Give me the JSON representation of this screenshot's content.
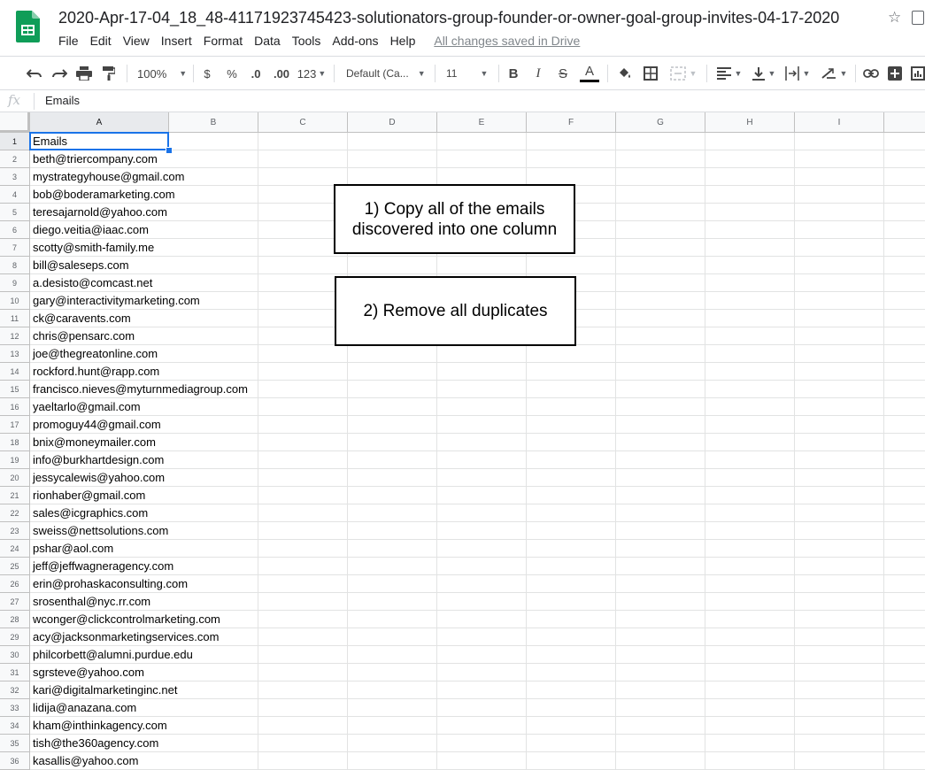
{
  "document": {
    "title": "2020-Apr-17-04_18_48-41171923745423-solutionators-group-founder-or-owner-goal-group-invites-04-17-2020",
    "saved_status": "All changes saved in Drive"
  },
  "menu": [
    "File",
    "Edit",
    "View",
    "Insert",
    "Format",
    "Data",
    "Tools",
    "Add-ons",
    "Help"
  ],
  "toolbar": {
    "zoom": "100%",
    "currency": "$",
    "percent": "%",
    "decrease_decimals": ".0",
    "increase_decimals": ".00",
    "more_formats": "123",
    "font": "Default (Ca...",
    "font_size": "11",
    "bold": "B",
    "italic": "I",
    "strikethrough": "S",
    "text_color": "A"
  },
  "formula_bar": {
    "fx": "fx",
    "content": "Emails"
  },
  "columns": [
    "A",
    "B",
    "C",
    "D",
    "E",
    "F",
    "G",
    "H",
    "I"
  ],
  "rows": [
    "1",
    "2",
    "3",
    "4",
    "5",
    "6",
    "7",
    "8",
    "9",
    "10",
    "11",
    "12",
    "13",
    "14",
    "15",
    "16",
    "17",
    "18",
    "19",
    "20",
    "21",
    "22",
    "23",
    "24",
    "25",
    "26",
    "27",
    "28",
    "29",
    "30",
    "31",
    "32",
    "33",
    "34",
    "35",
    "36"
  ],
  "cells_col_a": [
    "Emails",
    "beth@triercompany.com",
    "mystrategyhouse@gmail.com",
    "bob@boderamarketing.com",
    "teresajarnold@yahoo.com",
    "diego.veitia@iaac.com",
    "scotty@smith-family.me",
    "bill@saleseps.com",
    "a.desisto@comcast.net",
    "gary@interactivitymarketing.com",
    "ck@caravents.com",
    "chris@pensarc.com",
    "joe@thegreatonline.com",
    "rockford.hunt@rapp.com",
    "francisco.nieves@myturnmediagroup.com",
    "yaeltarlo@gmail.com",
    "promoguy44@gmail.com",
    "bnix@moneymailer.com",
    "info@burkhartdesign.com",
    "jessycalewis@yahoo.com",
    "rionhaber@gmail.com",
    "sales@icgraphics.com",
    "sweiss@nettsolutions.com",
    "pshar@aol.com",
    "jeff@jeffwagneragency.com",
    "erin@prohaskaconsulting.com",
    "srosenthal@nyc.rr.com",
    "wconger@clickcontrolmarketing.com",
    "acy@jacksonmarketingservices.com",
    "philcorbett@alumni.purdue.edu",
    "sgrsteve@yahoo.com",
    "kari@digitalmarketinginc.net",
    "lidija@anazana.com",
    "kham@inthinkagency.com",
    "tish@the360agency.com",
    "kasallis@yahoo.com"
  ],
  "notes": {
    "step1": "1) Copy all of the emails discovered into one column",
    "step2": "2) Remove all duplicates"
  },
  "colors": {
    "accent": "#1a73e8",
    "sheets_green": "#0f9d58"
  }
}
